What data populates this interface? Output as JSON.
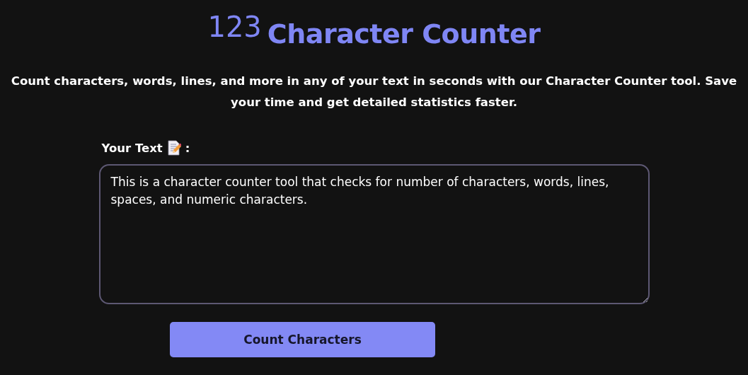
{
  "header": {
    "logo": "123",
    "title": "Character Counter"
  },
  "description": "Count characters, words, lines, and more in any of your text in seconds with our Character Counter tool. Save your time and get detailed statistics faster.",
  "field": {
    "label": "Your Text",
    "label_suffix": ":",
    "value": "This is a character counter tool that checks for number of characters, words, lines, spaces, and numeric characters."
  },
  "button": "Count Characters"
}
